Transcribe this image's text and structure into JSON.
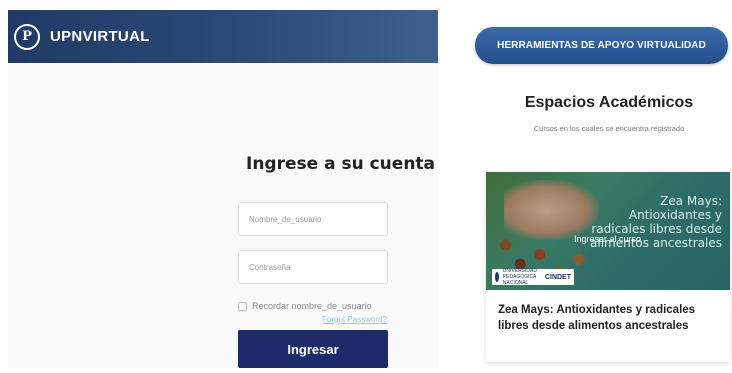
{
  "login": {
    "brand": "UPNVIRTUAL",
    "logo_letter": "P",
    "title": "Ingrese a su cuenta",
    "username_placeholder": "Nombre_de_usuario",
    "password_placeholder": "Contraseña",
    "remember_label": "Recordar nombre_de_usuario",
    "forgot_link": "Forgot Password?",
    "submit_label": "Ingresar"
  },
  "right": {
    "tools_button": "HERRAMIENTAS DE APOYO VIRTUALIDAD",
    "section_title": "Espacios Académicos",
    "section_subtitle": "Cursos en los cuales se encuentra registrado"
  },
  "course": {
    "image_title": "Zea Mays: Antioxidantes y radicales libres desde alimentos ancestrales",
    "image_overlay": "Ingresar al curso",
    "logo_small_text": "UNIVERSIDAD PEDAGÓGICA NACIONAL",
    "logo_cin": "CINDET",
    "title": "Zea Mays: Antioxidantes y radicales libres desde alimentos ancestrales"
  },
  "colors": {
    "topbar": "#2b4a7a",
    "login_button": "#1e2b6a",
    "tools_button": "#2f5b98",
    "forgot_link": "#8ecfe6"
  }
}
